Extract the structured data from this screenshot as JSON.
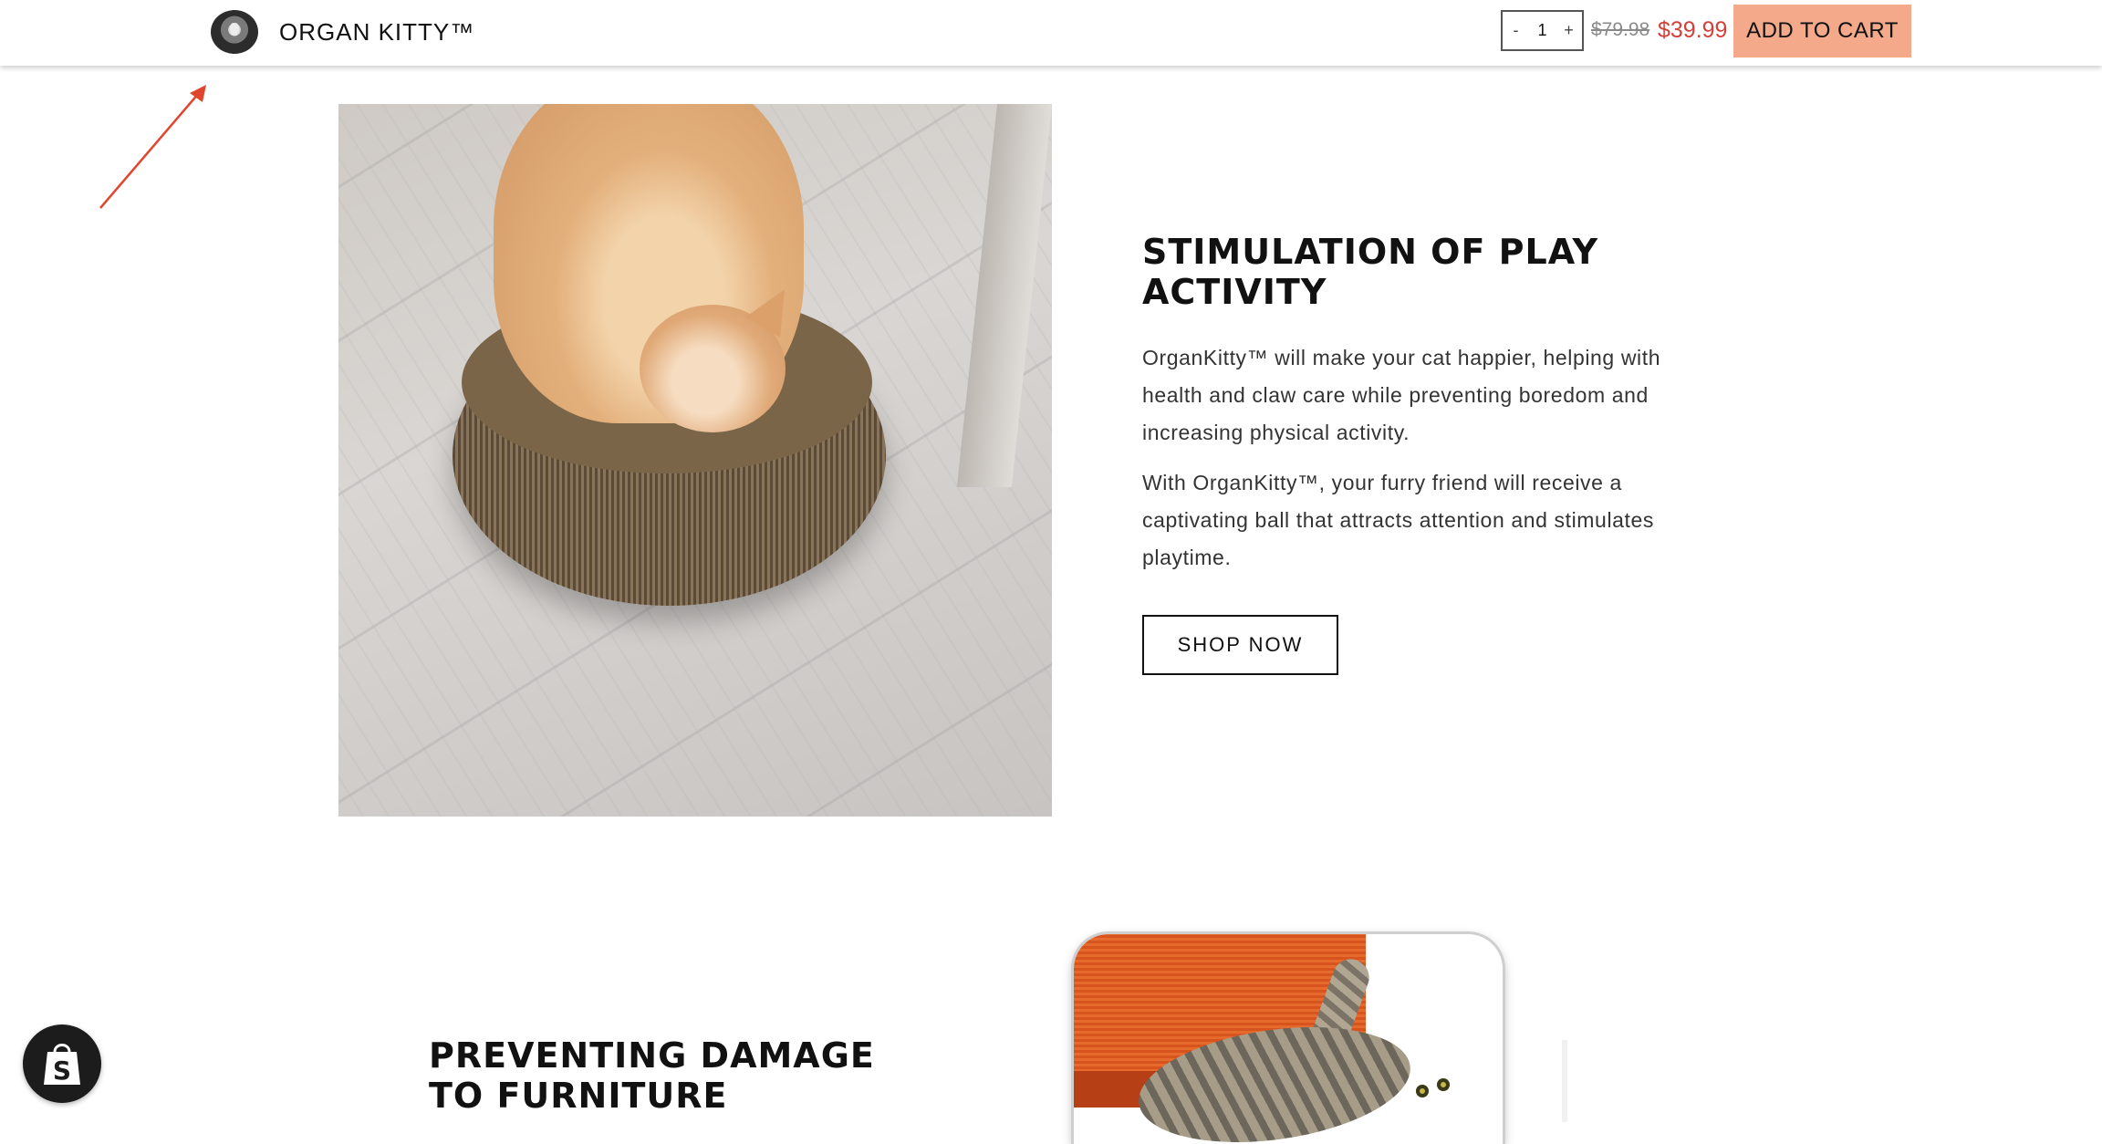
{
  "header": {
    "brand": "ORGAN KITTY™",
    "quantity": {
      "minus": "-",
      "value": "1",
      "plus": "+"
    },
    "old_price": "$79.98",
    "new_price": "$39.99",
    "add_to_cart": "ADD TO CART"
  },
  "section1": {
    "heading": "STIMULATION OF PLAY ACTIVITY",
    "paragraph1": "OrganKitty™ will make your cat happier, helping with health and claw care while preventing boredom and increasing physical activity.",
    "paragraph2": "With OrganKitty™, your furry friend will receive a captivating ball that attracts attention and stimulates playtime.",
    "cta": "SHOP NOW"
  },
  "section2": {
    "heading": "PREVENTING DAMAGE TO FURNITURE"
  },
  "colors": {
    "add_to_cart_bg": "#f3a98a",
    "sale_price": "#d2403a",
    "annotation_arrow": "#e0452e",
    "shopify_badge": "#1c1c1c"
  },
  "icons": {
    "logo": "brand-logo-icon",
    "arrow": "annotation-arrow-icon",
    "badge": "shopify-bag-icon"
  }
}
